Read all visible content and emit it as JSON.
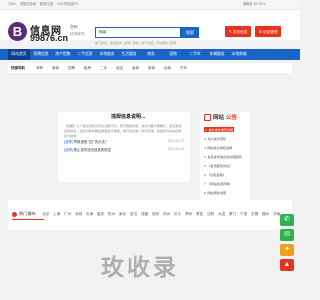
{
  "topbar": {
    "left_items": [
      "123fx ：旧版信息网",
      "登录/注册",
      "24小时热线/PC"
    ],
    "right_text": "湖南省 18~25℃"
  },
  "header": {
    "logo_letter": "B",
    "logo_name": "信息网",
    "logo_domain": "99876.cn",
    "logo_region": "台州",
    "logo_sub": "[切换城市]",
    "search_value": "搜索",
    "search_button": "搜索",
    "hot_words": "热门搜索：保洁服务 | 装修 | 家政 | 房产出租 | 汽车服务 | 招聘",
    "post_button": "发布信息",
    "manage_button": "信息管理"
  },
  "nav": {
    "items": [
      "网站首页",
      "招聘信息",
      "房产租售",
      "二手信息",
      "本地服务",
      "生活服务",
      "商务",
      "宠物",
      "二手车",
      "车辆服务",
      "本地商城"
    ]
  },
  "category_bar": {
    "title": "快捷导航",
    "items": [
      "求职",
      "家政",
      "招聘",
      "租房",
      "二手",
      "保洁",
      "装修",
      "维修",
      "出租",
      "汽车"
    ]
  },
  "notice": {
    "title": "违规信息说明...",
    "body": "【提醒】以下信息经核实存在违规行为，现已删除处理，信息内容不再展示。如您发现违规信息，请及时联系网站客服进行举报，我们将在第一时间处理。感谢您对本站的支持与监督。",
    "links": [
      {
        "tag": "[违规]",
        "text": "举报违规 “招” 的办法？",
        "date": "2023-01-27"
      },
      {
        "tag": "[违规]",
        "text": "禁止发布违法信息的规定",
        "date": "2023-01-13"
      }
    ]
  },
  "announce": {
    "title_part1": "网站",
    "title_part2": "公告",
    "items": [
      "1. 信息发布规范说明",
      "2. 用户发布须知",
      "3. 网站信息审核说明",
      "4. 免费发布信息的处理说明",
      "5. 《会员服务协议》",
      "6. 《隐私政策》",
      "7. 《网站免责声明》",
      "8. 网站更新说明"
    ]
  },
  "hot_city": {
    "title": "热门城市",
    "cities": [
      "北京",
      "上海",
      "广州",
      "深圳",
      "天津",
      "重庆",
      "杭州",
      "南京",
      "武汉",
      "成都",
      "西安",
      "苏州",
      "长沙",
      "郑州",
      "青岛",
      "沈阳",
      "大连",
      "厦门",
      "宁波",
      "无锡",
      "福州",
      "济南"
    ]
  },
  "watermark": "玫收录",
  "colors": {
    "brand_blue": "#1a64c8",
    "nav_active": "#0b3f8f",
    "accent_red": "#e8331c",
    "side_green": "#2fb24c",
    "side_orange": "#f0a020",
    "logo_purple": "#5b2a78"
  },
  "side_icons": [
    "wechat-icon",
    "wechat-share-icon",
    "qq-icon",
    "back-to-top-icon"
  ]
}
